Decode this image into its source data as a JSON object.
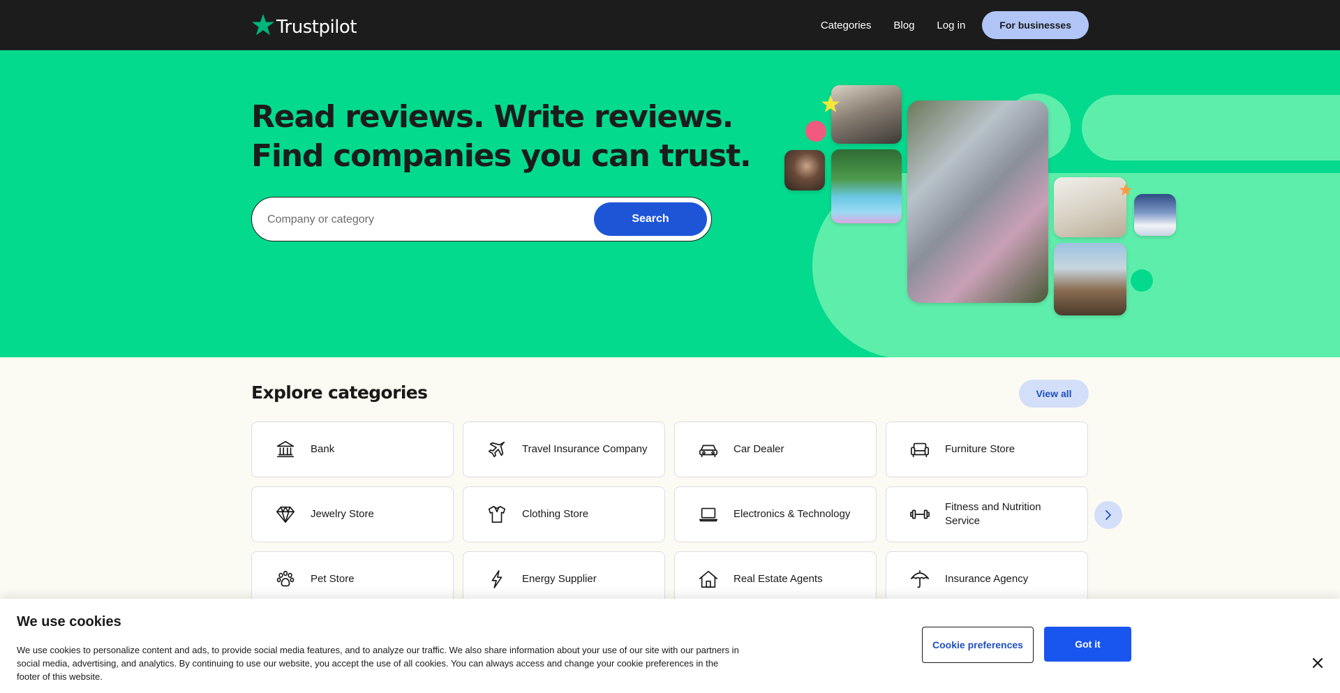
{
  "header": {
    "logo_text": "Trustpilot",
    "nav": [
      "Categories",
      "Blog",
      "Log in"
    ],
    "business_button": "For businesses"
  },
  "hero": {
    "headline_line1": "Read reviews. Write reviews.",
    "headline_line2": "Find companies you can trust.",
    "search_placeholder": "Company or category",
    "search_value": "",
    "search_button": "Search"
  },
  "categories": {
    "title": "Explore categories",
    "view_all": "View all",
    "items": [
      {
        "label": "Bank",
        "icon": "bank-icon"
      },
      {
        "label": "Travel Insurance Company",
        "icon": "airplane-icon"
      },
      {
        "label": "Car Dealer",
        "icon": "car-icon"
      },
      {
        "label": "Furniture Store",
        "icon": "sofa-icon"
      },
      {
        "label": "Jewelry Store",
        "icon": "diamond-icon"
      },
      {
        "label": "Clothing Store",
        "icon": "shirt-icon"
      },
      {
        "label": "Electronics & Technology",
        "icon": "laptop-icon"
      },
      {
        "label": "Fitness and Nutrition Service",
        "icon": "dumbbell-icon"
      },
      {
        "label": "Pet Store",
        "icon": "paw-icon"
      },
      {
        "label": "Energy Supplier",
        "icon": "lightning-icon"
      },
      {
        "label": "Real Estate Agents",
        "icon": "house-icon"
      },
      {
        "label": "Insurance Agency",
        "icon": "umbrella-icon"
      }
    ]
  },
  "cookie_banner": {
    "title": "We use cookies",
    "text": "We use cookies to personalize content and ads, to provide social media features, and to analyze our traffic. We also share information about your use of our site with our partners in social media, advertising, and analytics. By continuing to use our website, you accept the use of all cookies. You can always access and change your cookie preferences in the footer of this website.",
    "preferences_button": "Cookie preferences",
    "accept_button": "Got it"
  },
  "colors": {
    "header_bg": "#1c1c1c",
    "hero_green": "#04da8d",
    "accent_blue": "#1e55d6",
    "page_bg": "#fcfbf3",
    "star_green": "#00b67a"
  }
}
